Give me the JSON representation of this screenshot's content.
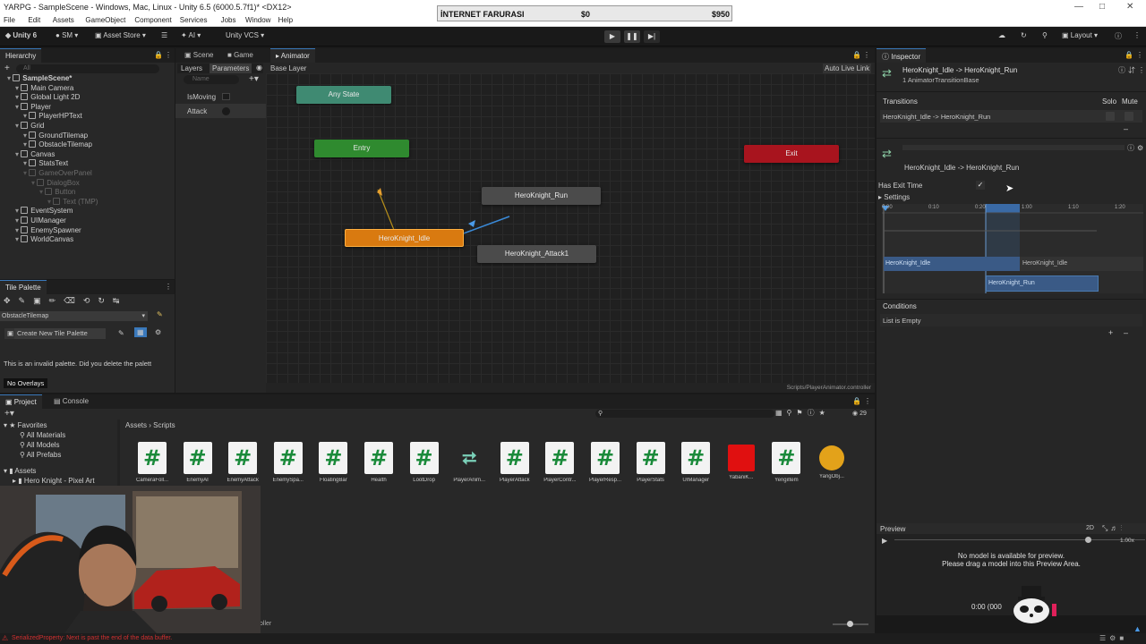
{
  "window": {
    "title": "YARPG - SampleScene - Windows, Mac, Linux - Unity 6.5 (6000.5.7f1)* <DX12>"
  },
  "menu": [
    "File",
    "Edit",
    "Assets",
    "GameObject",
    "Component",
    "Services",
    "Jobs",
    "Window",
    "Help"
  ],
  "ad_banner": {
    "name": "İNTERNET FARURASI",
    "left_value": "$0",
    "right_value": "$950"
  },
  "toolbar": {
    "unity": "Unity 6",
    "account": "SM",
    "asset_store": "Asset Store",
    "ai": "AI",
    "vcs": "Unity VCS",
    "layout": "Layout"
  },
  "hierarchy": {
    "tab": "Hierarchy",
    "search_placeholder": "All",
    "items": [
      {
        "label": "SampleScene*",
        "depth": 0,
        "dim": false
      },
      {
        "label": "Main Camera",
        "depth": 1,
        "dim": false
      },
      {
        "label": "Global Light 2D",
        "depth": 1,
        "dim": false
      },
      {
        "label": "Player",
        "depth": 1,
        "dim": false
      },
      {
        "label": "PlayerHPText",
        "depth": 2,
        "dim": false
      },
      {
        "label": "Grid",
        "depth": 1,
        "dim": false
      },
      {
        "label": "GroundTilemap",
        "depth": 2,
        "dim": false
      },
      {
        "label": "ObstacleTilemap",
        "depth": 2,
        "dim": false
      },
      {
        "label": "Canvas",
        "depth": 1,
        "dim": false
      },
      {
        "label": "StatsText",
        "depth": 2,
        "dim": false
      },
      {
        "label": "GameOverPanel",
        "depth": 2,
        "dim": true
      },
      {
        "label": "DialogBox",
        "depth": 3,
        "dim": true
      },
      {
        "label": "Button",
        "depth": 4,
        "dim": true
      },
      {
        "label": "Text (TMP)",
        "depth": 5,
        "dim": true
      },
      {
        "label": "EventSystem",
        "depth": 1,
        "dim": false
      },
      {
        "label": "UIManager",
        "depth": 1,
        "dim": false
      },
      {
        "label": "EnemySpawner",
        "depth": 1,
        "dim": false
      },
      {
        "label": "WorldCanvas",
        "depth": 1,
        "dim": false
      }
    ]
  },
  "tile_palette": {
    "tab": "Tile Palette",
    "target": "ObstacleTilemap",
    "create_button": "Create New Tile Palette",
    "message": "This is an invalid palette. Did you delete the palett",
    "overlay_button": "No Overlays"
  },
  "scene_tabs": [
    "Scene",
    "Game",
    "Animator"
  ],
  "animator": {
    "left_tabs": [
      "Layers",
      "Parameters"
    ],
    "breadcrumb": "Base Layer",
    "search_placeholder": "Name",
    "auto_live_link": "Auto Live Link",
    "parameters": [
      {
        "name": "IsMoving",
        "type": "bool"
      },
      {
        "name": "Attack",
        "type": "trigger"
      }
    ],
    "nodes": {
      "any_state": "Any State",
      "entry": "Entry",
      "exit": "Exit",
      "idle": "HeroKnight_Idle",
      "run": "HeroKnight_Run",
      "attack": "HeroKnight_Attack1"
    },
    "footer_path": "Scripts/PlayerAnimator.controller"
  },
  "inspector": {
    "tab": "Inspector",
    "header_title": "HeroKnight_Idle -> HeroKnight_Run",
    "header_subtitle": "1 AnimatorTransitionBase",
    "transitions_label": "Transitions",
    "solo": "Solo",
    "mute": "Mute",
    "transition_item": "HeroKnight_Idle -> HeroKnight_Run",
    "detail_title": "HeroKnight_Idle -> HeroKnight_Run",
    "has_exit_time_label": "Has Exit Time",
    "has_exit_time": true,
    "settings_label": "Settings",
    "timeline_ticks": [
      "0:00",
      "0:10",
      "0:20",
      "1:00",
      "1:10",
      "1:20"
    ],
    "timeline_src1": "HeroKnight_Idle",
    "timeline_src2": "HeroKnight_Idle",
    "timeline_dst": "HeroKnight_Run",
    "conditions_label": "Conditions",
    "conditions_empty": "List is Empty",
    "preview_label": "Preview",
    "preview_mode": "2D",
    "preview_speed": "1.00x",
    "preview_message_1": "No model is available for preview.",
    "preview_message_2": "Please drag a model into this Preview Area.",
    "preview_time": "0:00 (000"
  },
  "project": {
    "tabs": [
      "Project",
      "Console"
    ],
    "favorites_label": "Favorites",
    "favorites": [
      "All Materials",
      "All Models",
      "All Prefabs"
    ],
    "assets_label": "Assets",
    "assets_child": "Hero Knight - Pixel Art",
    "breadcrumb": [
      "Assets",
      "Scripts"
    ],
    "hidden_count": "29",
    "files": [
      {
        "name": "CameraFoll...",
        "kind": "script"
      },
      {
        "name": "EnemyAI",
        "kind": "script"
      },
      {
        "name": "EnemyAttack",
        "kind": "script"
      },
      {
        "name": "EnemySpa...",
        "kind": "script"
      },
      {
        "name": "FloatingBar",
        "kind": "script"
      },
      {
        "name": "Health",
        "kind": "script"
      },
      {
        "name": "LootDrop",
        "kind": "script"
      },
      {
        "name": "PlayerAnim...",
        "kind": "animator"
      },
      {
        "name": "PlayerAttack",
        "kind": "script"
      },
      {
        "name": "PlayerContr...",
        "kind": "script"
      },
      {
        "name": "PlayerResp...",
        "kind": "script"
      },
      {
        "name": "PlayerStats",
        "kind": "script"
      },
      {
        "name": "UIManager",
        "kind": "script"
      },
      {
        "name": "YabaniK...",
        "kind": "red"
      },
      {
        "name": "YengiItem",
        "kind": "script"
      },
      {
        "name": "YangObj...",
        "kind": "yellow"
      }
    ],
    "footer_partial": "oller"
  },
  "status_bar": {
    "error": "SerializedProperty: Next is past the end of the data buffer."
  }
}
